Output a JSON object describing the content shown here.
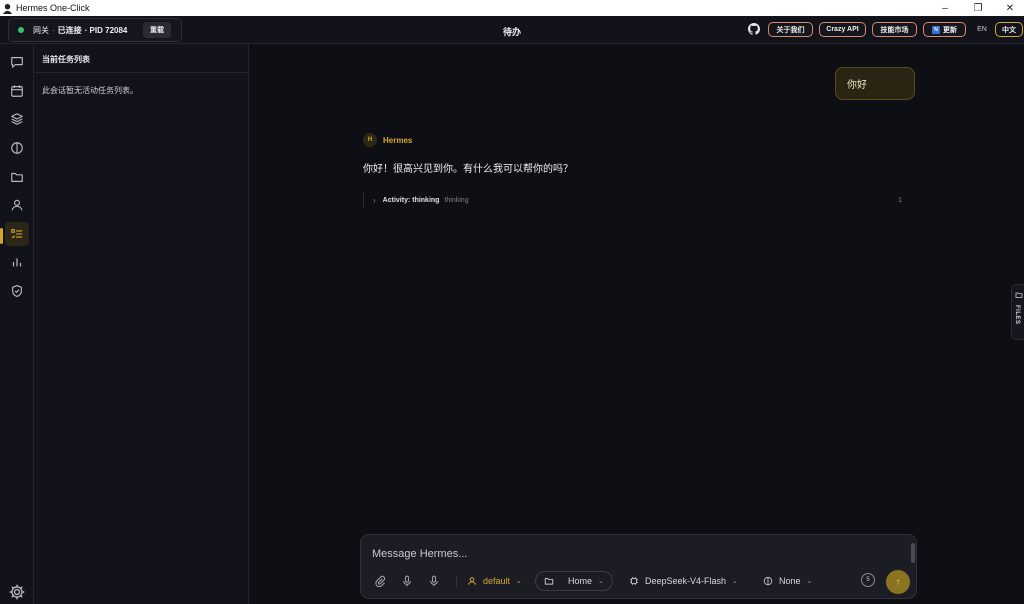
{
  "window": {
    "title": "Hermes One-Click",
    "controls": {
      "minimize": "–",
      "maximize": "❐",
      "close": "✕"
    }
  },
  "header": {
    "gateway_label": "网关",
    "gateway_sep": "·",
    "connected_label": "已连接",
    "pid_label": "· PID 72084",
    "reload_label": "重载",
    "page_title": "待办",
    "buttons": [
      {
        "label": "关于我们"
      },
      {
        "label": "Crazy API"
      },
      {
        "label": "技能市场"
      },
      {
        "label": "更新",
        "badge": "N"
      }
    ],
    "lang_en": "EN",
    "lang_zh": "中文"
  },
  "sidebar": {
    "items": [
      {
        "icon": "chat-icon"
      },
      {
        "icon": "calendar-icon"
      },
      {
        "icon": "layers-icon"
      },
      {
        "icon": "circle-half-icon"
      },
      {
        "icon": "folder-icon"
      },
      {
        "icon": "user-icon"
      },
      {
        "icon": "todo-list-icon",
        "active": true
      },
      {
        "icon": "bar-chart-icon"
      },
      {
        "icon": "shield-check-icon"
      }
    ],
    "settings_icon": "gear-icon"
  },
  "panel": {
    "title": "当前任务列表",
    "empty_text": "此会话暂无活动任务列表。"
  },
  "chat": {
    "user_message": "你好",
    "bot_avatar": "H",
    "bot_name": "Hermes",
    "bot_message": "你好！很高兴见到你。有什么我可以帮你的吗？",
    "activity": {
      "chevron": "›",
      "label": "Activity: thinking",
      "sub": "thinking",
      "count": "1"
    }
  },
  "files_tab": {
    "label": "FILES"
  },
  "composer": {
    "placeholder": "Message Hermes...",
    "profile": "default",
    "folder": "Home",
    "model": "DeepSeek-V4-Flash",
    "reasoning": "None",
    "context_count": "5",
    "send_glyph": "↑",
    "caret": "⌄"
  },
  "colors": {
    "accent": "#d4a72c",
    "button_border": "#d38b6b",
    "status_online": "#35c46a",
    "background": "#0e0e15"
  }
}
